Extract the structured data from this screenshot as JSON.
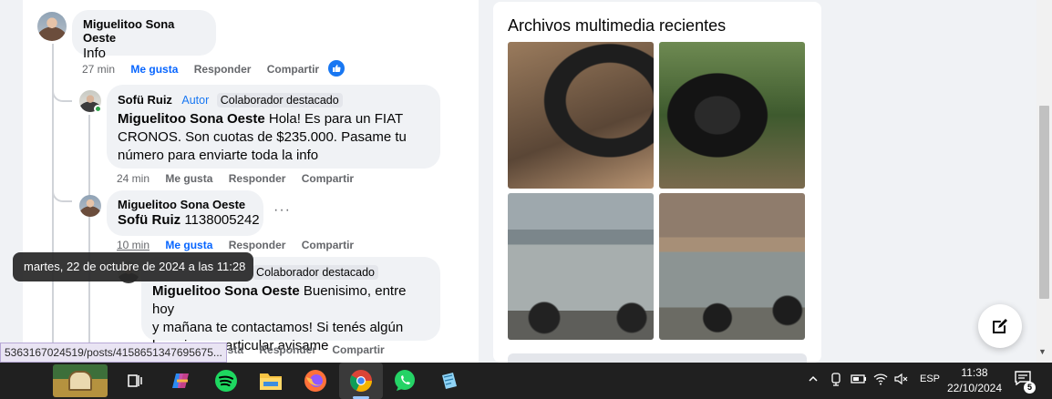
{
  "comments": [
    {
      "author": "Miguelitoo Sona Oeste",
      "text": "Info",
      "time": "27 min",
      "actions": [
        "Me gusta",
        "Responder",
        "Compartir"
      ]
    },
    {
      "author": "Sofü Ruiz",
      "author_tag": "Autor",
      "badge": "Colaborador destacado",
      "mention": "Miguelitoo Sona Oeste",
      "text_lines": [
        "Hola! Es para un FIAT",
        "CRONOS. Son cuotas de $235.000. Pasame tu",
        "número para enviarte toda la info"
      ],
      "time": "24 min",
      "actions": [
        "Me gusta",
        "Responder",
        "Compartir"
      ]
    },
    {
      "author": "Miguelitoo Sona Oeste",
      "mention": "Sofü Ruiz",
      "text": "1138005242",
      "time": "10 min",
      "actions": [
        "Me gusta",
        "Responder",
        "Compartir"
      ]
    },
    {
      "badge": "Colaborador destacado",
      "mention": "Miguelitoo Sona Oeste",
      "text_lines": [
        "Buenisimo, entre hoy",
        "y mañana te contactamos! Si tenés algún",
        "horario en particular avisame"
      ],
      "actions": [
        "gusta",
        "Responder",
        "Compartir"
      ]
    }
  ],
  "tooltip": "martes, 22 de octubre de 2024 a las 11:28",
  "status_url": "5363167024519/posts/4158651347695675...",
  "media": {
    "title": "Archivos multimedia recientes",
    "photos": [
      "tire-photo",
      "tire-closeup-photo",
      "car-photo-front",
      "car-photo-side"
    ]
  },
  "taskbar": {
    "language": "ESP",
    "time": "11:38",
    "date": "22/10/2024",
    "notifications": "5"
  },
  "colors": {
    "facebook_blue": "#1877f2",
    "like_blue": "#0866ff",
    "online_green": "#31a24c"
  }
}
